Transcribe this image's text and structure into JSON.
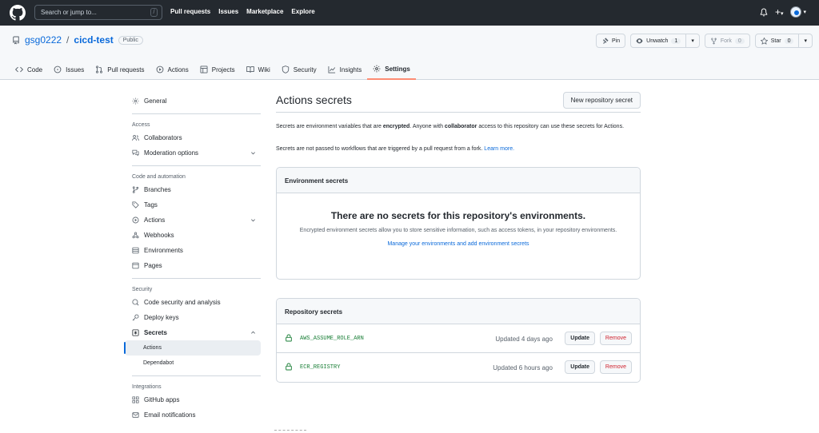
{
  "topbar": {
    "search_placeholder": "Search or jump to...",
    "search_key": "/",
    "nav": [
      "Pull requests",
      "Issues",
      "Marketplace",
      "Explore"
    ],
    "plus": "+",
    "caret": "▾"
  },
  "repo": {
    "owner": "gsg0222",
    "separator": "/",
    "name": "cicd-test",
    "visibility": "Public",
    "actions": {
      "pin": "Pin",
      "unwatch": "Unwatch",
      "unwatch_count": "1",
      "fork": "Fork",
      "fork_count": "0",
      "star": "Star",
      "star_count": "0"
    },
    "tabs": [
      "Code",
      "Issues",
      "Pull requests",
      "Actions",
      "Projects",
      "Wiki",
      "Security",
      "Insights",
      "Settings"
    ]
  },
  "sidebar": {
    "general": "General",
    "access_heading": "Access",
    "access": [
      "Collaborators",
      "Moderation options"
    ],
    "code_heading": "Code and automation",
    "code": [
      "Branches",
      "Tags",
      "Actions",
      "Webhooks",
      "Environments",
      "Pages"
    ],
    "security_heading": "Security",
    "security": [
      "Code security and analysis",
      "Deploy keys",
      "Secrets"
    ],
    "secrets_sub": [
      "Actions",
      "Dependabot"
    ],
    "integrations_heading": "Integrations",
    "integrations": [
      "GitHub apps",
      "Email notifications"
    ]
  },
  "main": {
    "title": "Actions secrets",
    "new_button": "New repository secret",
    "desc1_a": "Secrets are environment variables that are ",
    "desc1_b": "encrypted",
    "desc1_c": ". Anyone with ",
    "desc1_d": "collaborator",
    "desc1_e": " access to this repository can use these secrets for Actions.",
    "desc2": "Secrets are not passed to workflows that are triggered by a pull request from a fork. ",
    "learn_more": "Learn more.",
    "env": {
      "heading": "Environment secrets",
      "blank_title": "There are no secrets for this repository's environments.",
      "blank_desc": "Encrypted environment secrets allow you to store sensitive information, such as access tokens, in your repository environments.",
      "blank_link": "Manage your environments and add environment secrets"
    },
    "repo_secrets": {
      "heading": "Repository secrets",
      "update_label": "Update",
      "remove_label": "Remove",
      "items": [
        {
          "name": "AWS_ASSUME_ROLE_ARN",
          "updated": "Updated 4 days ago"
        },
        {
          "name": "ECR_REGISTRY",
          "updated": "Updated 6 hours ago"
        }
      ]
    }
  }
}
